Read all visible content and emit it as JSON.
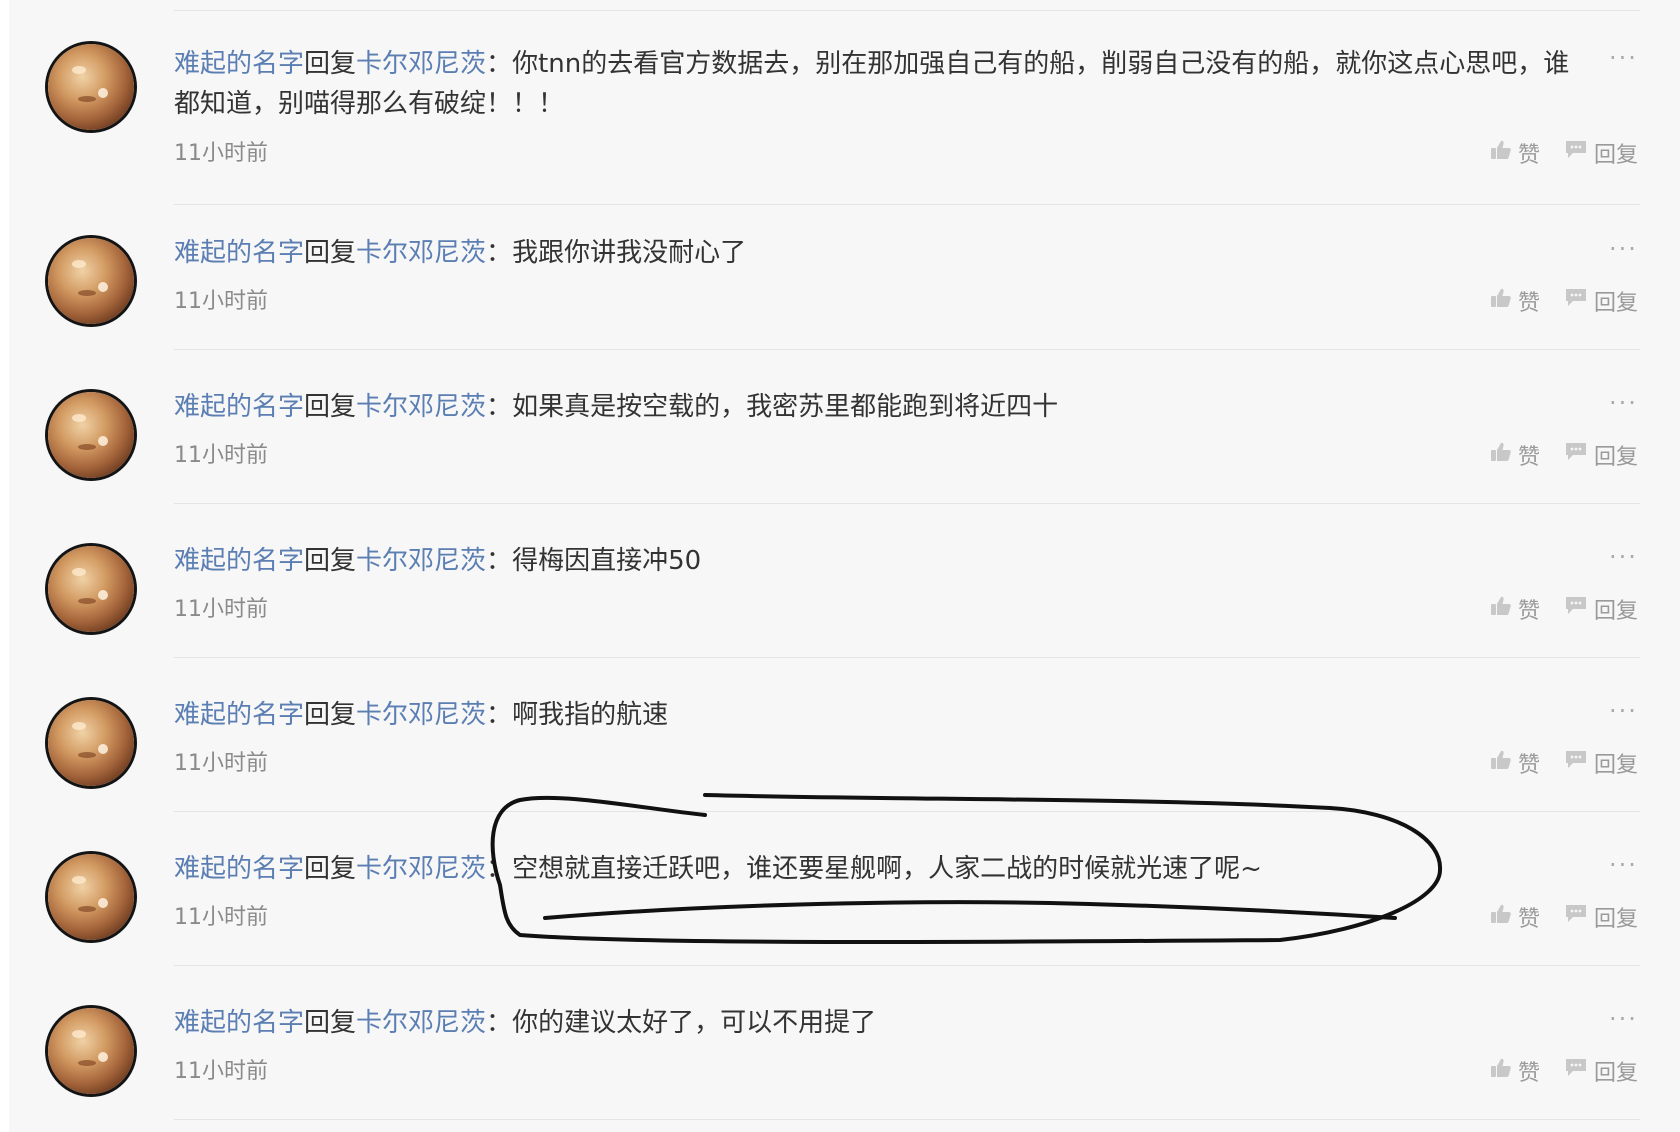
{
  "comments": [
    {
      "author": "难起的名字",
      "reply_word": "回复",
      "target": "卡尔邓尼茨",
      "colon": "：",
      "text": "你tnn的去看官方数据去，别在那加强自己有的船，削弱自己没有的船，就你这点心思吧，谁都知道，别喵得那么有破绽！！！",
      "time": "11小时前",
      "like_label": "赞",
      "reply_label": "回复",
      "more": "···"
    },
    {
      "author": "难起的名字",
      "reply_word": "回复",
      "target": "卡尔邓尼茨",
      "colon": "：",
      "text": "我跟你讲我没耐心了",
      "time": "11小时前",
      "like_label": "赞",
      "reply_label": "回复",
      "more": "···"
    },
    {
      "author": "难起的名字",
      "reply_word": "回复",
      "target": "卡尔邓尼茨",
      "colon": "：",
      "text": "如果真是按空载的，我密苏里都能跑到将近四十",
      "time": "11小时前",
      "like_label": "赞",
      "reply_label": "回复",
      "more": "···"
    },
    {
      "author": "难起的名字",
      "reply_word": "回复",
      "target": "卡尔邓尼茨",
      "colon": "：",
      "text": "得梅因直接冲50",
      "time": "11小时前",
      "like_label": "赞",
      "reply_label": "回复",
      "more": "···"
    },
    {
      "author": "难起的名字",
      "reply_word": "回复",
      "target": "卡尔邓尼茨",
      "colon": "：",
      "text": "啊我指的航速",
      "time": "11小时前",
      "like_label": "赞",
      "reply_label": "回复",
      "more": "···"
    },
    {
      "author": "难起的名字",
      "reply_word": "回复",
      "target": "卡尔邓尼茨",
      "colon": "：",
      "text": "空想就直接迁跃吧，谁还要星舰啊，人家二战的时候就光速了呢~",
      "time": "11小时前",
      "like_label": "赞",
      "reply_label": "回复",
      "more": "···"
    },
    {
      "author": "难起的名字",
      "reply_word": "回复",
      "target": "卡尔邓尼茨",
      "colon": "：",
      "text": "你的建议太好了，可以不用提了",
      "time": "11小时前",
      "like_label": "赞",
      "reply_label": "回复",
      "more": "···"
    }
  ],
  "icons": {
    "like": "thumbs-up-icon",
    "reply": "speech-bubble-icon",
    "more": "more-dots-icon"
  },
  "colors": {
    "link": "#5b7eb3",
    "text": "#333333",
    "muted": "#8a8a8a",
    "annotation": "#111111"
  }
}
